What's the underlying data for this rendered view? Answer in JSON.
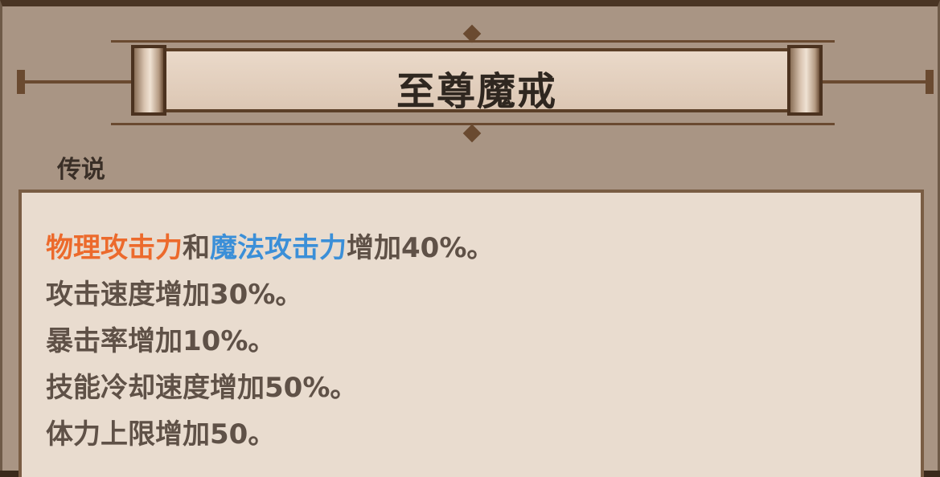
{
  "item": {
    "name": "至尊魔戒",
    "rarity": "传说"
  },
  "description": {
    "line1": {
      "phys": "物理攻击力",
      "conj": "和",
      "magic": "魔法攻击力",
      "rest": "增加40%。"
    },
    "line2": "攻击速度增加30%。",
    "line3": "暴击率增加10%。",
    "line4": "技能冷却速度增加50%。",
    "line5": "体力上限增加50。"
  },
  "colors": {
    "physical": "#ec6a2c",
    "magic": "#3b8fd8",
    "text": "#5f5147"
  }
}
